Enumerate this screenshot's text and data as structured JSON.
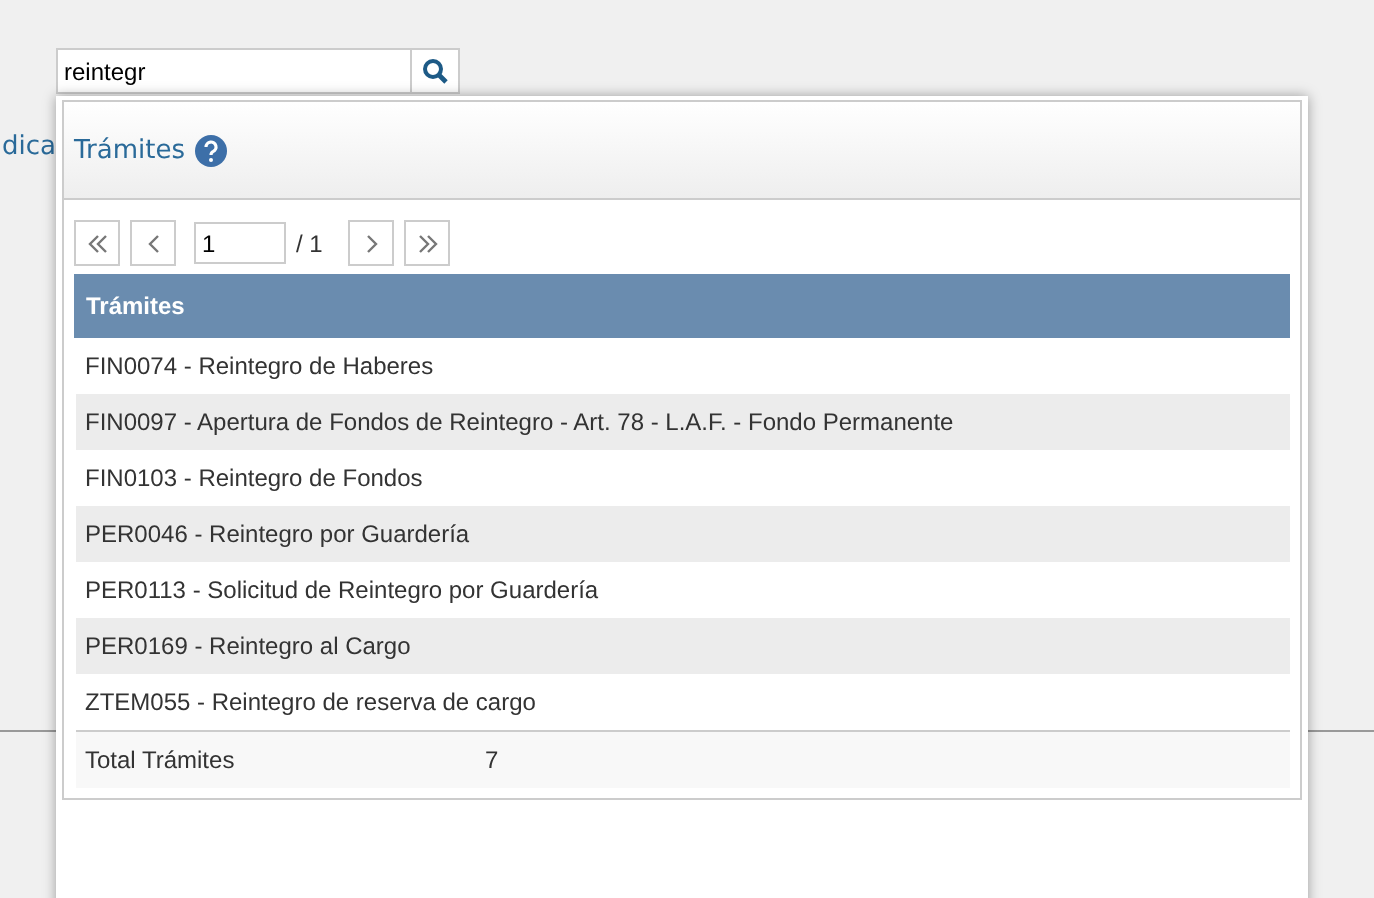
{
  "search": {
    "value": "reintegr"
  },
  "background_link": {
    "label": "dica"
  },
  "panel": {
    "title": "Trámites",
    "pager": {
      "page": "1",
      "of": "/ 1"
    },
    "table": {
      "columns": [
        "Trámites"
      ],
      "rows": [
        {
          "text": "FIN0074 - Reintegro de Haberes"
        },
        {
          "text": "FIN0097 - Apertura de Fondos de Reintegro - Art. 78 - L.A.F. - Fondo Permanente"
        },
        {
          "text": "FIN0103 - Reintegro de Fondos"
        },
        {
          "text": "PER0046 - Reintegro por Guardería"
        },
        {
          "text": "PER0113 - Solicitud de Reintegro por Guardería"
        },
        {
          "text": "PER0169 - Reintegro al Cargo"
        },
        {
          "text": "ZTEM055 - Reintegro de reserva de cargo"
        }
      ],
      "footer": {
        "label": "Total Trámites",
        "count": "7"
      }
    }
  }
}
